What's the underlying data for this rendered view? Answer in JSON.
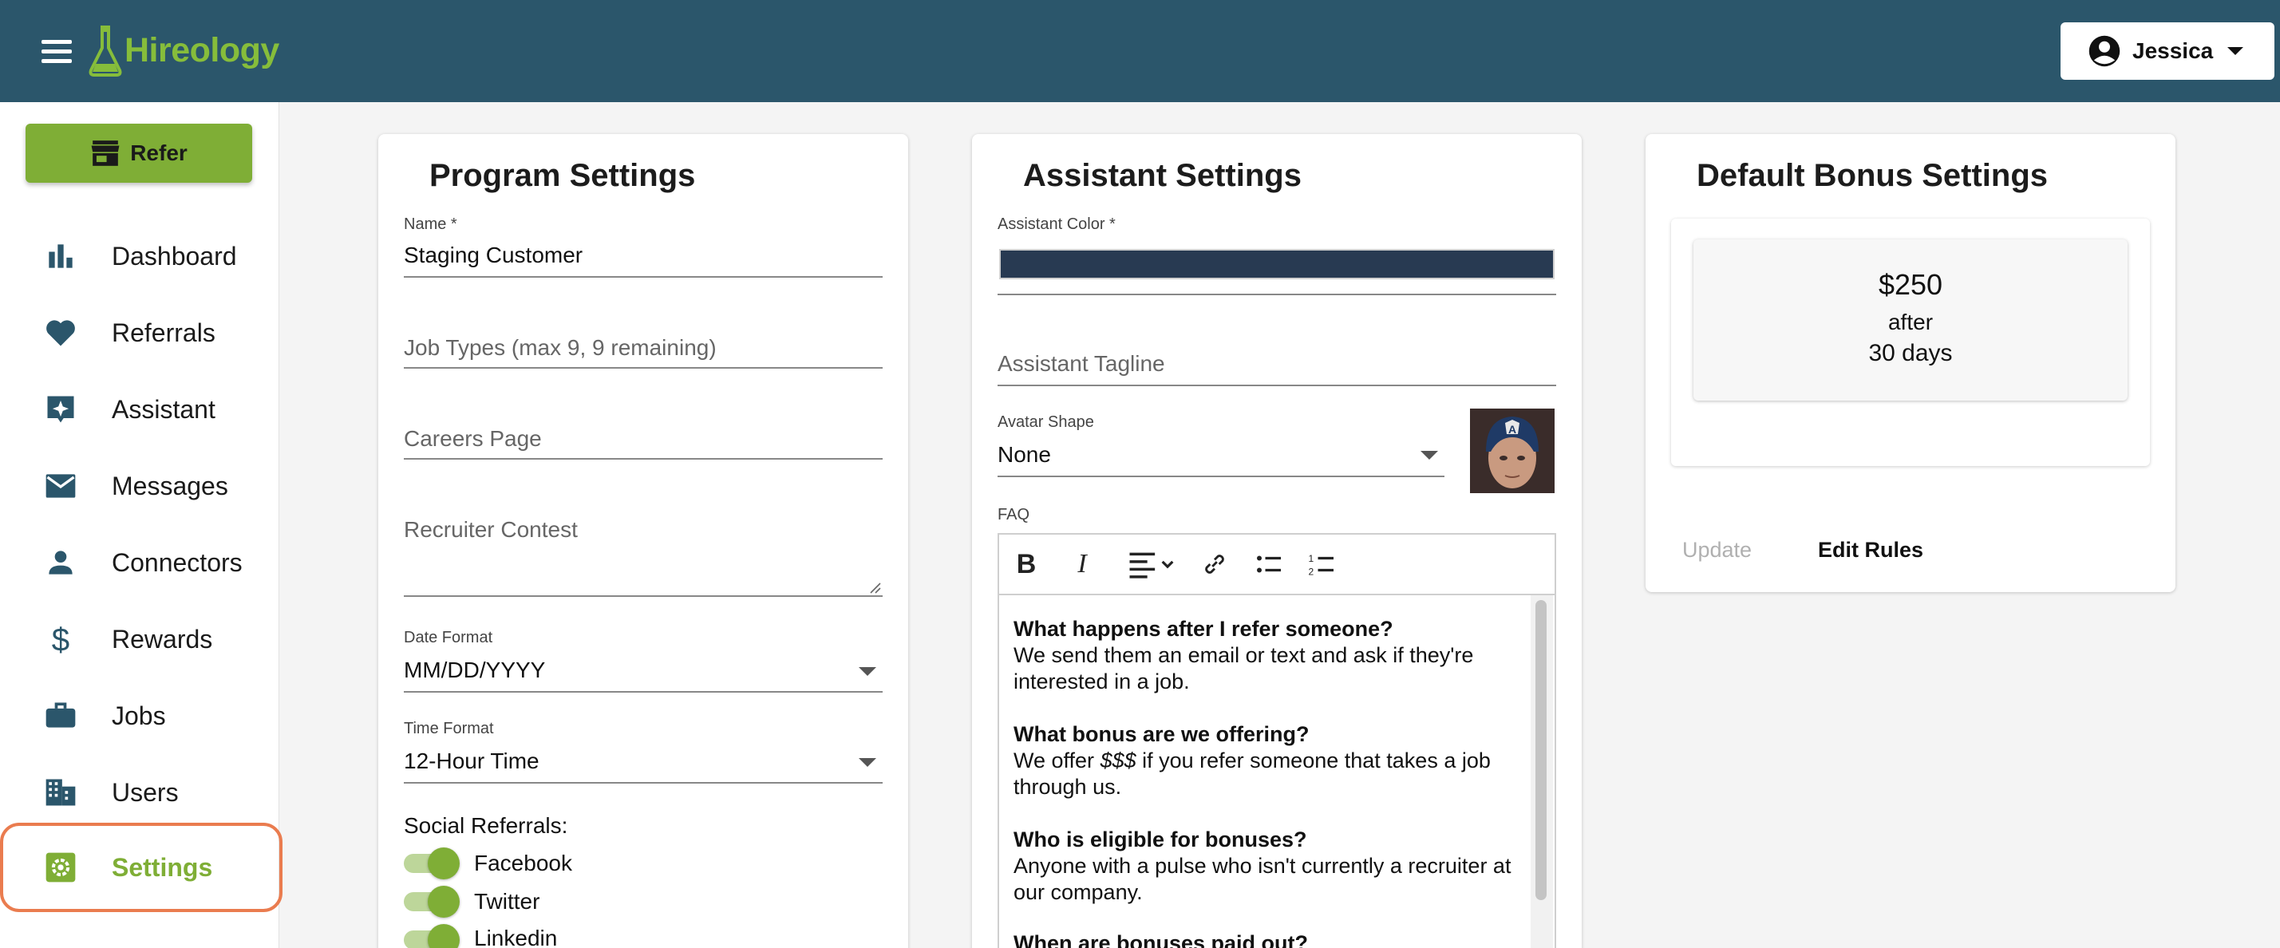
{
  "header": {
    "app_name": "Hireology",
    "user_name": "Jessica",
    "brand_color": "#2b566b",
    "accent_color": "#7fae36"
  },
  "sidebar": {
    "refer_label": "Refer",
    "items": [
      {
        "label": "Dashboard",
        "icon": "bar-chart-icon"
      },
      {
        "label": "Referrals",
        "icon": "heart-icon"
      },
      {
        "label": "Assistant",
        "icon": "sparkle-assistant-icon"
      },
      {
        "label": "Messages",
        "icon": "envelope-icon"
      },
      {
        "label": "Connectors",
        "icon": "person-icon"
      },
      {
        "label": "Rewards",
        "icon": "dollar-icon"
      },
      {
        "label": "Jobs",
        "icon": "briefcase-icon"
      },
      {
        "label": "Users",
        "icon": "building-icon"
      },
      {
        "label": "Settings",
        "icon": "gear-icon"
      }
    ],
    "active_item": "Settings"
  },
  "program_settings": {
    "title": "Program Settings",
    "name_label": "Name *",
    "name_value": "Staging Customer",
    "job_types_placeholder": "Job Types (max 9, 9 remaining)",
    "careers_page_placeholder": "Careers Page",
    "recruiter_contest_placeholder": "Recruiter Contest",
    "date_format_label": "Date Format",
    "date_format_value": "MM/DD/YYYY",
    "time_format_label": "Time Format",
    "time_format_value": "12-Hour Time",
    "social_referrals_label": "Social Referrals:",
    "social": [
      {
        "label": "Facebook",
        "enabled": true
      },
      {
        "label": "Twitter",
        "enabled": true
      },
      {
        "label": "Linkedin",
        "enabled": true
      }
    ]
  },
  "assistant_settings": {
    "title": "Assistant Settings",
    "color_label": "Assistant Color *",
    "color_value": "#283a52",
    "tagline_placeholder": "Assistant Tagline",
    "avatar_shape_label": "Avatar Shape",
    "avatar_shape_value": "None",
    "faq_label": "FAQ",
    "faq": [
      {
        "q": "What happens after I refer someone?",
        "a": "We send them an email or text and ask if they're interested in a job."
      },
      {
        "q": "What bonus are we offering?",
        "a_pre": "We offer ",
        "a_em": "$$$",
        "a_post": " if you refer someone that takes a job through us."
      },
      {
        "q": "Who is eligible for bonuses?",
        "a": "Anyone with a pulse who isn't currently a recruiter at our company."
      },
      {
        "q": "When are bonuses paid out?",
        "a": ""
      }
    ]
  },
  "bonus_settings": {
    "title": "Default Bonus Settings",
    "amount": "$250",
    "after": "after",
    "days": "30 days",
    "update_label": "Update",
    "edit_rules_label": "Edit Rules"
  }
}
